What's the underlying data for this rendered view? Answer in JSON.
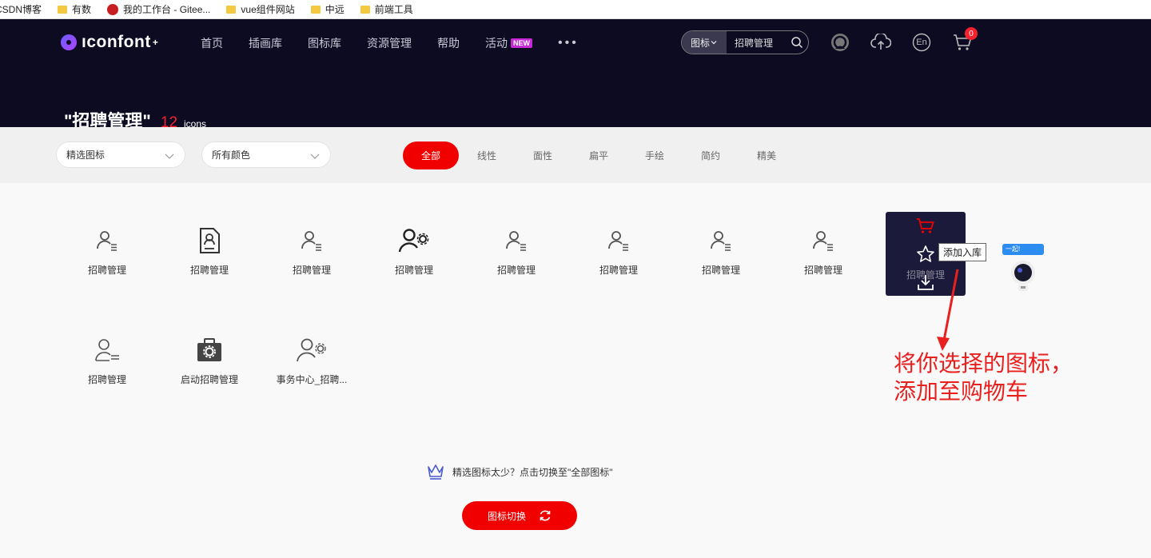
{
  "bookmarks": [
    {
      "label": "CSDN博客",
      "icon": "none"
    },
    {
      "label": "有数",
      "icon": "folder-icon"
    },
    {
      "label": "我的工作台 - Gitee...",
      "icon": "gitee-icon"
    },
    {
      "label": "vue组件网站",
      "icon": "folder-icon"
    },
    {
      "label": "中远",
      "icon": "folder-icon"
    },
    {
      "label": "前端工具",
      "icon": "folder-icon"
    }
  ],
  "header": {
    "logo_text": "ıconfont",
    "logo_star": "+",
    "nav": [
      "首页",
      "插画库",
      "图标库",
      "资源管理",
      "帮助"
    ],
    "nav_activity": "活动",
    "nav_new_badge": "NEW",
    "nav_more": "•••",
    "search_type": "图标",
    "search_query": "招聘管理",
    "cart_count": "0",
    "lang_label": "En"
  },
  "page": {
    "title": "\"招聘管理\"",
    "count": "12",
    "count_unit": "icons"
  },
  "filters": {
    "select1": "精选图标",
    "select2": "所有颜色",
    "tabs": [
      "全部",
      "线性",
      "面性",
      "扁平",
      "手绘",
      "简约",
      "精美"
    ],
    "active_tab": "全部"
  },
  "icons": [
    {
      "label": "招聘管理",
      "icon": "user-list-icon"
    },
    {
      "label": "招聘管理",
      "icon": "resume-document-icon"
    },
    {
      "label": "招聘管理",
      "icon": "user-list-icon"
    },
    {
      "label": "招聘管理",
      "icon": "user-gear-icon"
    },
    {
      "label": "招聘管理",
      "icon": "user-list-icon"
    },
    {
      "label": "招聘管理",
      "icon": "user-list-icon"
    },
    {
      "label": "招聘管理",
      "icon": "user-list-icon"
    },
    {
      "label": "招聘管理",
      "icon": "user-list-icon"
    },
    {
      "label": "招聘管理",
      "icon": "user-list-icon"
    },
    {
      "label": "招聘管理",
      "icon": "user-outline-list-icon"
    },
    {
      "label": "启动招聘管理",
      "icon": "briefcase-gear-icon"
    },
    {
      "label": "事务中心_招聘...",
      "icon": "user-gear-outline-icon"
    }
  ],
  "hover_card": {
    "under_label": "招聘管理",
    "actions": [
      "cart-icon",
      "star-icon",
      "download-icon"
    ]
  },
  "tooltip": "添加入库",
  "mascot_bubble": "一起!",
  "annotation": [
    "将你选择的图标，",
    "添加至购物车"
  ],
  "tip_text": "精选图标太少？点击切换至\"全部图标\"",
  "switch_button": "图标切换",
  "colors": {
    "header_bg": "#0c0b22",
    "accent": "#f10000",
    "annotation": "#e8201e"
  }
}
